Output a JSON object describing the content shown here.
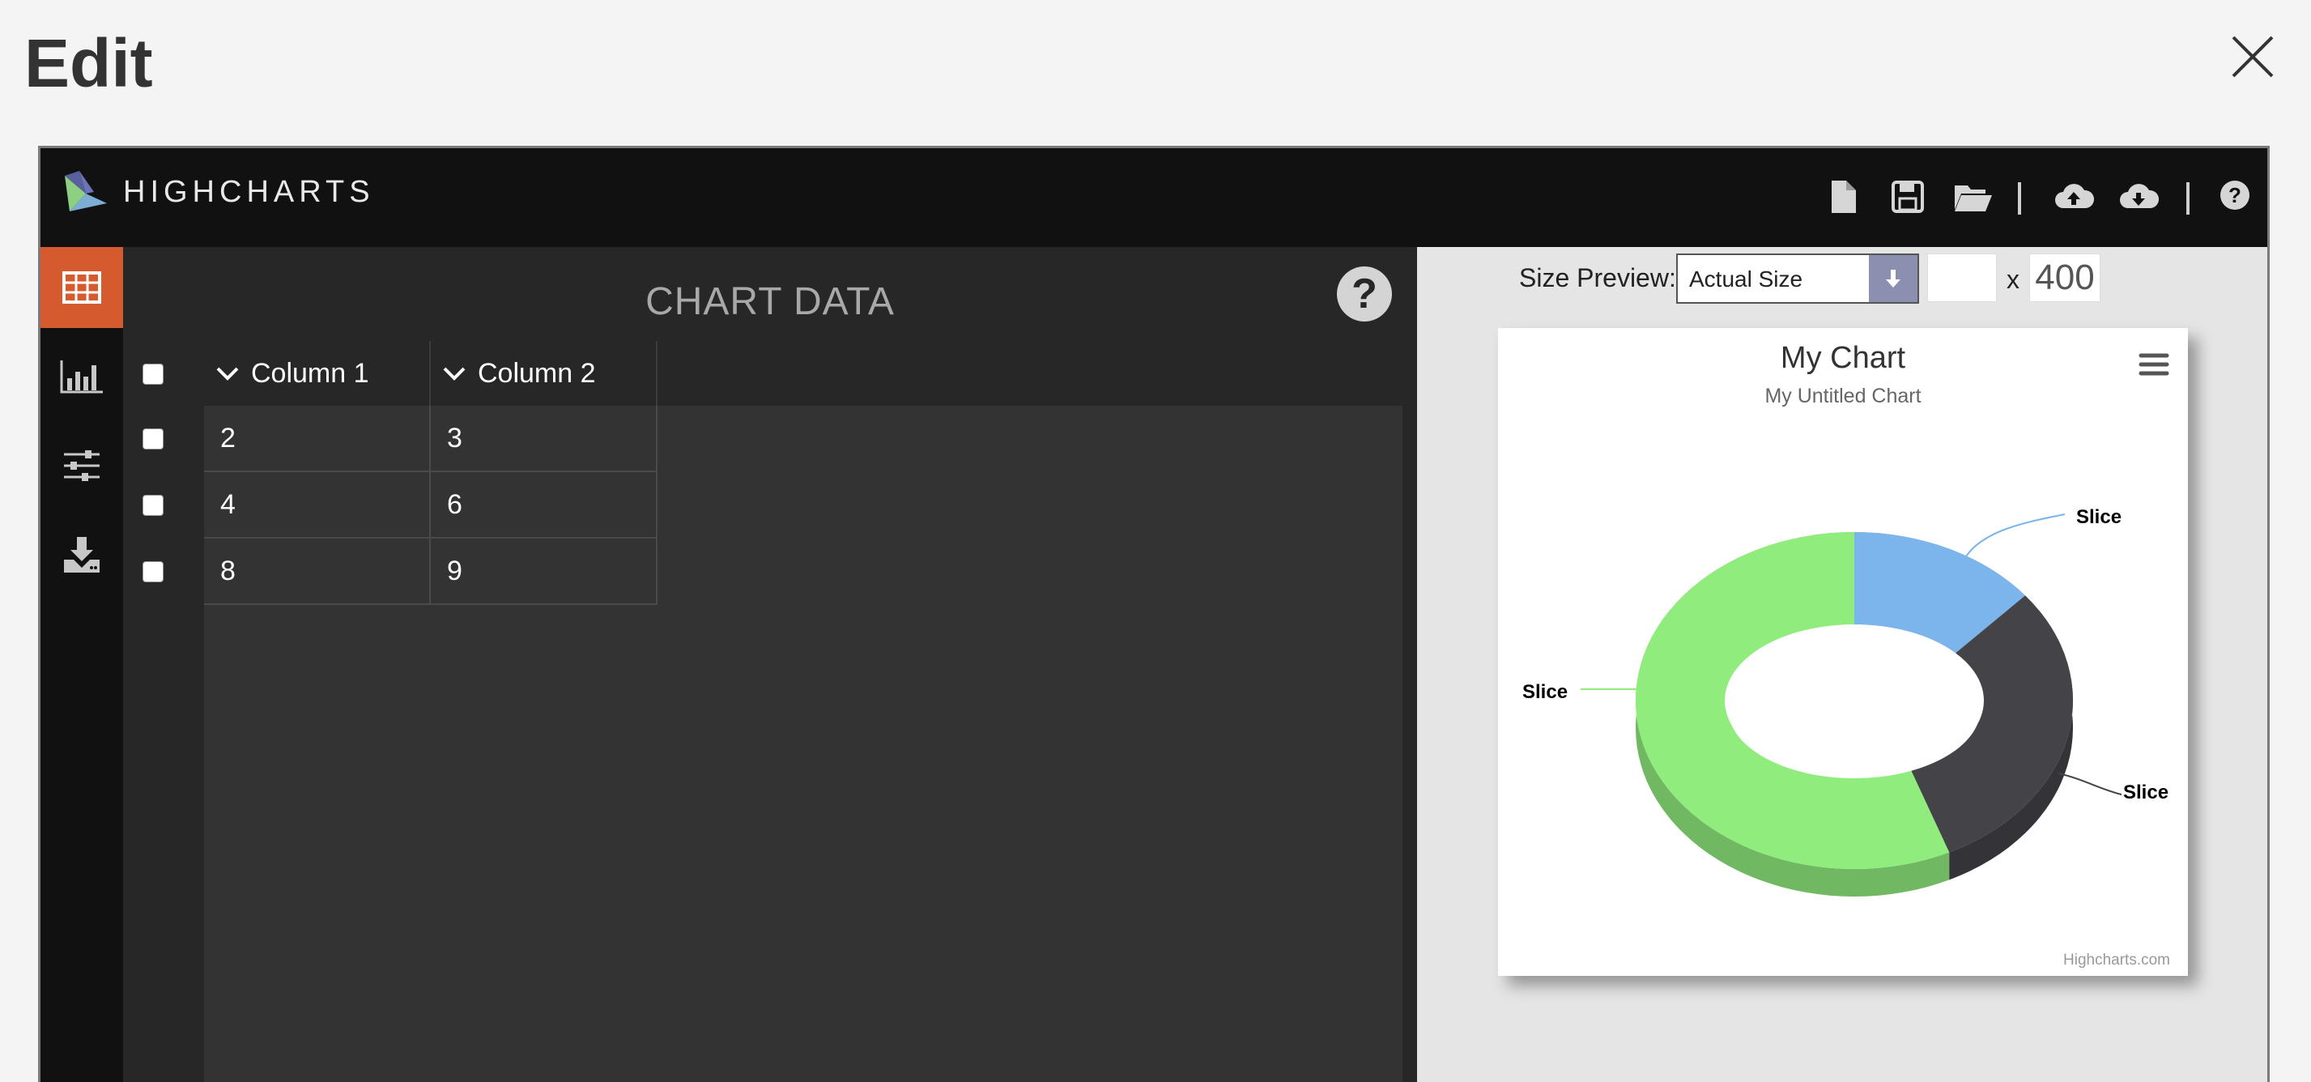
{
  "dialog": {
    "title": "Edit",
    "close_icon": "close-icon"
  },
  "app": {
    "logo_text": "HIGHCHARTS"
  },
  "toolbar": {
    "icons": [
      "new-file-icon",
      "save-icon",
      "open-folder-icon",
      "cloud-upload-icon",
      "cloud-download-icon",
      "help-icon"
    ]
  },
  "sidebar": {
    "items": [
      {
        "name": "table-icon",
        "active": true
      },
      {
        "name": "bar-chart-icon",
        "active": false
      },
      {
        "name": "sliders-icon",
        "active": false
      },
      {
        "name": "download-icon",
        "active": false
      }
    ],
    "active_color": "#d55a2e"
  },
  "data_panel": {
    "title": "CHART DATA",
    "help": "?",
    "columns": [
      "Column 1",
      "Column 2"
    ],
    "rows": [
      [
        "2",
        "3"
      ],
      [
        "4",
        "6"
      ],
      [
        "8",
        "9"
      ]
    ]
  },
  "preview": {
    "size_label": "Size Preview:",
    "size_option": "Actual Size",
    "width_value": "",
    "x_label": "x",
    "height_value": "400"
  },
  "chart_data": {
    "type": "pie",
    "title": "My Chart",
    "subtitle": "My Untitled Chart",
    "donut": true,
    "three_d": true,
    "slices": [
      {
        "label": "Slice",
        "value": 2,
        "color": "#7cb5ec"
      },
      {
        "label": "Slice",
        "value": 4,
        "color": "#434348"
      },
      {
        "label": "Slice",
        "value": 8,
        "color": "#90ed7d"
      }
    ],
    "credits": "Highcharts.com"
  }
}
